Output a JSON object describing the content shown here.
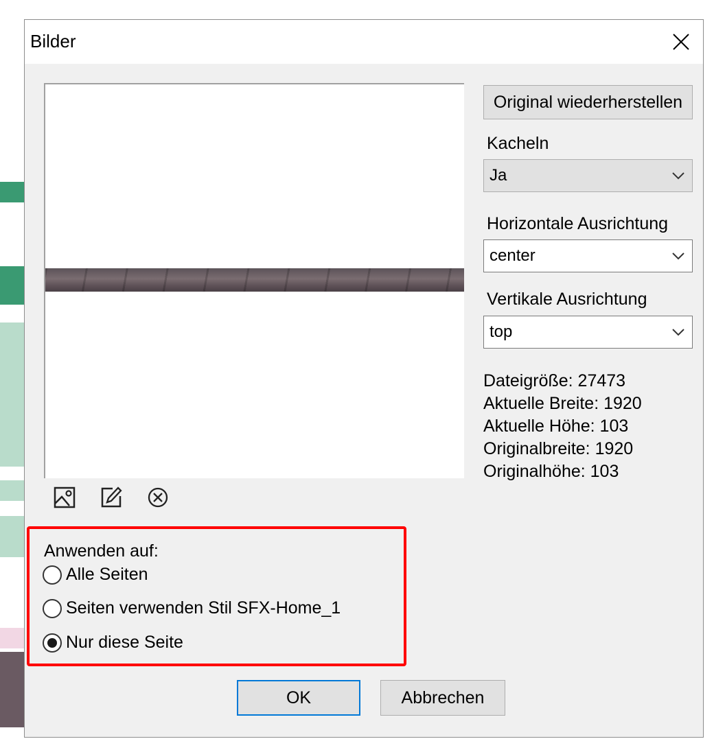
{
  "dialog": {
    "title": "Bilder",
    "restore_button": "Original wiederherstellen",
    "tiling": {
      "label": "Kacheln",
      "value": "Ja"
    },
    "horizontal_alignment": {
      "label": "Horizontale Ausrichtung",
      "value": "center"
    },
    "vertical_alignment": {
      "label": "Vertikale Ausrichtung",
      "value": "top"
    },
    "info": {
      "file_size": "Dateigröße: 27473",
      "current_width": "Aktuelle Breite: 1920",
      "current_height": "Aktuelle Höhe: 103",
      "original_width": "Originalbreite: 1920",
      "original_height": "Originalhöhe: 103"
    },
    "toolbar_icons": [
      "image-icon",
      "edit-icon",
      "remove-icon"
    ],
    "apply_to": {
      "label": "Anwenden auf:",
      "options": [
        {
          "label": "Alle Seiten",
          "selected": false
        },
        {
          "label": "Seiten verwenden Stil SFX-Home_1",
          "selected": false
        },
        {
          "label": "Nur diese Seite",
          "selected": true
        }
      ]
    },
    "ok_button": "OK",
    "cancel_button": "Abbrechen"
  },
  "colors": {
    "highlight_border": "#ff0000",
    "ok_border": "#0078d7",
    "dialog_bg": "#f0f0f0"
  }
}
